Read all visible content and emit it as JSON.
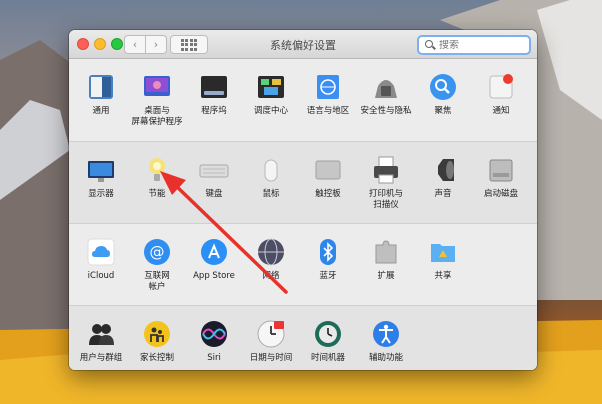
{
  "window": {
    "title": "系统偏好设置"
  },
  "search": {
    "placeholder": "搜索"
  },
  "rows": [
    {
      "items": [
        {
          "label": "通用",
          "icon": "general-icon"
        },
        {
          "label": "桌面与\n屏幕保护程序",
          "icon": "desktop-icon"
        },
        {
          "label": "程序坞",
          "icon": "dock-icon"
        },
        {
          "label": "调度中心",
          "icon": "mission-control-icon"
        },
        {
          "label": "语言与地区",
          "icon": "language-icon"
        },
        {
          "label": "安全性与隐私",
          "icon": "security-icon"
        },
        {
          "label": "聚焦",
          "icon": "spotlight-icon"
        },
        {
          "label": "通知",
          "icon": "notifications-icon"
        }
      ]
    },
    {
      "items": [
        {
          "label": "显示器",
          "icon": "display-icon"
        },
        {
          "label": "节能",
          "icon": "energy-icon"
        },
        {
          "label": "键盘",
          "icon": "keyboard-icon"
        },
        {
          "label": "鼠标",
          "icon": "mouse-icon"
        },
        {
          "label": "触控板",
          "icon": "trackpad-icon"
        },
        {
          "label": "打印机与\n扫描仪",
          "icon": "printer-icon"
        },
        {
          "label": "声音",
          "icon": "sound-icon"
        },
        {
          "label": "启动磁盘",
          "icon": "startup-disk-icon"
        }
      ]
    },
    {
      "items": [
        {
          "label": "iCloud",
          "icon": "icloud-icon"
        },
        {
          "label": "互联网\n帐户",
          "icon": "internet-accounts-icon"
        },
        {
          "label": "App Store",
          "icon": "app-store-icon"
        },
        {
          "label": "网络",
          "icon": "network-icon"
        },
        {
          "label": "蓝牙",
          "icon": "bluetooth-icon"
        },
        {
          "label": "扩展",
          "icon": "extensions-icon"
        },
        {
          "label": "共享",
          "icon": "sharing-icon"
        }
      ]
    },
    {
      "items": [
        {
          "label": "用户与群组",
          "icon": "users-icon"
        },
        {
          "label": "家长控制",
          "icon": "parental-controls-icon"
        },
        {
          "label": "Siri",
          "icon": "siri-icon"
        },
        {
          "label": "日期与时间",
          "icon": "date-time-icon"
        },
        {
          "label": "时间机器",
          "icon": "time-machine-icon"
        },
        {
          "label": "辅助功能",
          "icon": "accessibility-icon"
        }
      ]
    }
  ]
}
